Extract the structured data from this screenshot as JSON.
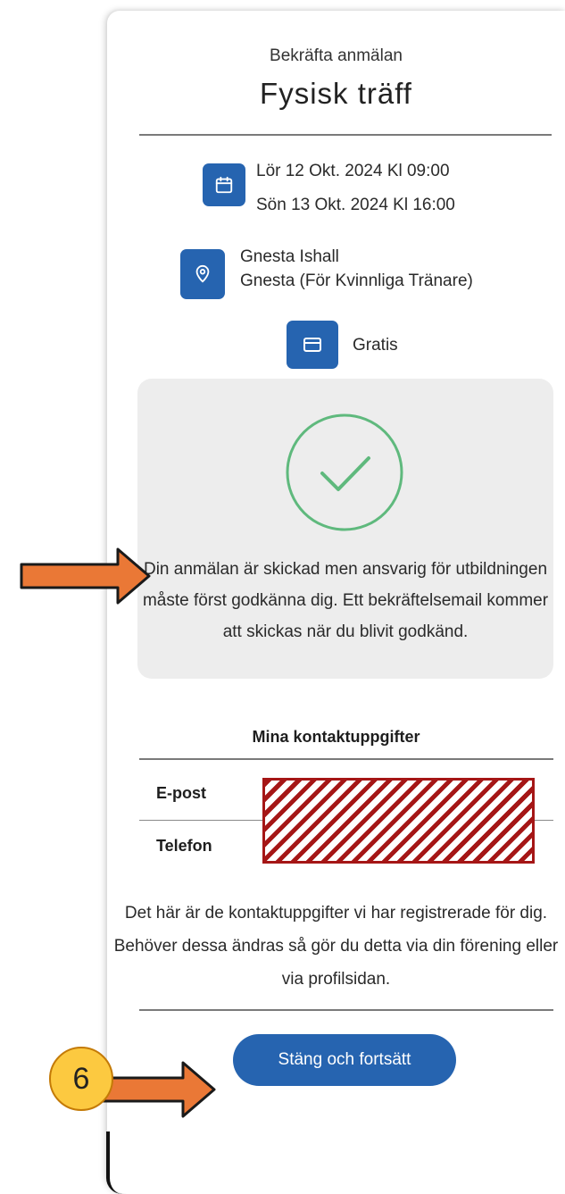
{
  "header": {
    "subtitle": "Bekräfta anmälan",
    "title": "Fysisk träff"
  },
  "event": {
    "date_start": "Lör 12 Okt. 2024 Kl 09:00",
    "date_end": "Sön 13 Okt. 2024 Kl 16:00",
    "location_name": "Gnesta Ishall",
    "location_detail": "Gnesta (För Kvinnliga Tränare)",
    "price": "Gratis",
    "icons": [
      "calendar-icon",
      "location-pin-icon",
      "payment-card-icon"
    ]
  },
  "confirmation": {
    "message": "Din anmälan är skickad men ansvarig för utbildningen måste först godkänna dig. Ett bekräftelsemail kommer att skickas när du blivit godkänd.",
    "icon": "check-circle-icon"
  },
  "contacts": {
    "title": "Mina kontaktuppgifter",
    "email_label": "E-post",
    "phone_label": "Telefon",
    "help_text": "Det här är de kontaktuppgifter vi har registrerade för dig. Behöver dessa ändras så gör du detta via din förening eller via profilsidan."
  },
  "actions": {
    "close_label": "Stäng och fortsätt"
  },
  "annotation": {
    "step_number": "6"
  },
  "colors": {
    "accent": "#2664b0",
    "check": "#5fb97d",
    "panel_bg": "#ededed",
    "annotation_arrow": "#ea7836",
    "annotation_badge": "#fcc940",
    "redaction": "#a51616"
  }
}
